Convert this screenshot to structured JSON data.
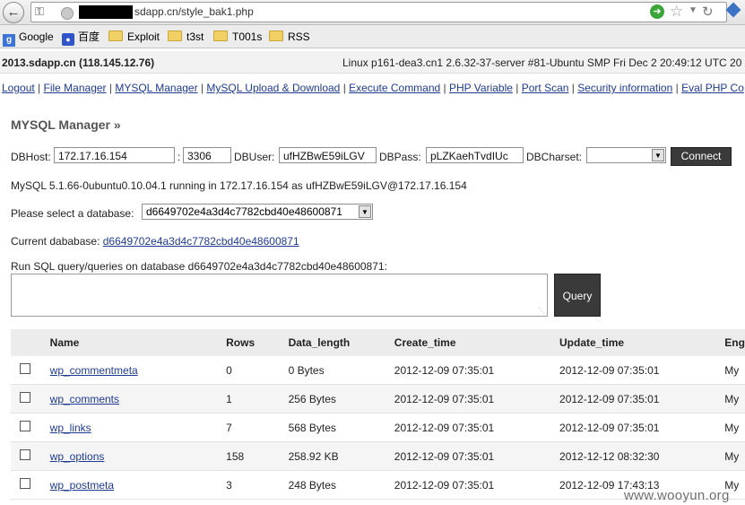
{
  "browser": {
    "url": "sdapp.cn/style_bak1.php",
    "bookmarks": [
      "Google",
      "百度",
      "Exploit",
      "t3st",
      "T001s",
      "RSS"
    ]
  },
  "header": {
    "hostname": "2013.sdapp.cn (118.145.12.76)",
    "sysinfo": "Linux p161-dea3.cn1 2.6.32-37-server #81-Ubuntu SMP Fri Dec 2 20:49:12 UTC 20"
  },
  "menu": [
    "Logout",
    "File Manager",
    "MYSQL Manager",
    "MySQL Upload & Download",
    "Execute Command",
    "PHP Variable",
    "Port Scan",
    "Security information",
    "Eval PHP Co"
  ],
  "mysql": {
    "title": "MYSQL Manager »",
    "host_label": "DBHost:",
    "host": "172.17.16.154",
    "colon": ":",
    "port": "3306",
    "user_label": "DBUser:",
    "user": "ufHZBwE59iLGV",
    "pass_label": "DBPass:",
    "pass": "pLZKaehTvdIUc",
    "charset_label": "DBCharset:",
    "charset": "",
    "connect_label": "Connect",
    "status": "MySQL 5.1.66-0ubuntu0.10.04.1 running in 172.17.16.154 as ufHZBwE59iLGV@172.17.16.154",
    "select_label": "Please select a database:",
    "selected_db": "d6649702e4a3d4c7782cbd40e48600871",
    "current_label": "Current dababase:",
    "current_db": "d6649702e4a3d4c7782cbd40e48600871",
    "sql_label": "Run SQL query/queries on database d6649702e4a3d4c7782cbd40e48600871:",
    "query_label": "Query"
  },
  "table": {
    "headers": [
      "Name",
      "Rows",
      "Data_length",
      "Create_time",
      "Update_time",
      "Eng"
    ],
    "rows": [
      {
        "name": "wp_commentmeta",
        "rows": "0",
        "data_length": "0 Bytes",
        "create_time": "2012-12-09 07:35:01",
        "update_time": "2012-12-09 07:35:01",
        "engine": "My"
      },
      {
        "name": "wp_comments",
        "rows": "1",
        "data_length": "256 Bytes",
        "create_time": "2012-12-09 07:35:01",
        "update_time": "2012-12-09 07:35:01",
        "engine": "My"
      },
      {
        "name": "wp_links",
        "rows": "7",
        "data_length": "568 Bytes",
        "create_time": "2012-12-09 07:35:01",
        "update_time": "2012-12-09 07:35:01",
        "engine": "My"
      },
      {
        "name": "wp_options",
        "rows": "158",
        "data_length": "258.92 KB",
        "create_time": "2012-12-09 07:35:01",
        "update_time": "2012-12-12 08:32:30",
        "engine": "My"
      },
      {
        "name": "wp_postmeta",
        "rows": "3",
        "data_length": "248 Bytes",
        "create_time": "2012-12-09 07:35:01",
        "update_time": "2012-12-09 17:43:13",
        "engine": "My"
      }
    ]
  },
  "watermark": "www.wooyun.org"
}
